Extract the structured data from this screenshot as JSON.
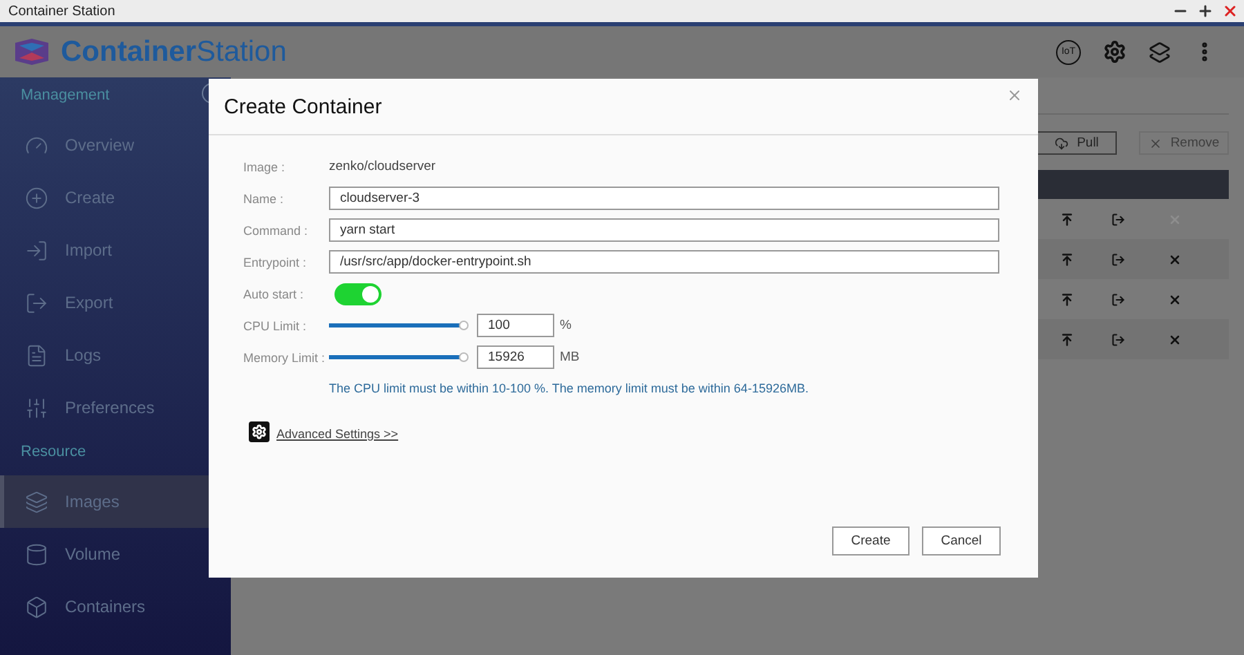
{
  "window": {
    "title": "Container Station"
  },
  "app": {
    "logo_bold": "Container",
    "logo_light": "Station",
    "iot_badge": "IoT"
  },
  "sidebar": {
    "sections": [
      {
        "title": "Management",
        "items": [
          {
            "label": "Overview",
            "selected": false
          },
          {
            "label": "Create",
            "selected": false
          },
          {
            "label": "Import",
            "selected": false
          },
          {
            "label": "Export",
            "selected": false
          },
          {
            "label": "Logs",
            "selected": false
          },
          {
            "label": "Preferences",
            "selected": false
          }
        ]
      },
      {
        "title": "Resource",
        "items": [
          {
            "label": "Images",
            "selected": true
          },
          {
            "label": "Volume",
            "selected": false
          },
          {
            "label": "Containers",
            "selected": false
          }
        ]
      }
    ]
  },
  "toolbar": {
    "buttons": [
      {
        "label": "Pull",
        "kind": "pull",
        "disabled": false
      },
      {
        "label": "Remove",
        "kind": "remove",
        "disabled": true
      }
    ]
  },
  "table": {
    "rows": [
      {
        "remove_disabled": true
      },
      {
        "remove_disabled": false
      },
      {
        "remove_disabled": false
      },
      {
        "remove_disabled": false
      }
    ]
  },
  "dialog": {
    "title": "Create Container",
    "image_label": "Image :",
    "image": "zenko/cloudserver",
    "fields": [
      {
        "label": "Name :",
        "value": "cloudserver-3"
      },
      {
        "label": "Command :",
        "value": "yarn start"
      },
      {
        "label": "Entrypoint :",
        "value": "/usr/src/app/docker-entrypoint.sh"
      }
    ],
    "auto_start": {
      "label": "Auto start :",
      "on": true
    },
    "limits": [
      {
        "label": "CPU Limit :",
        "level": 1,
        "value": "100",
        "unit": "%"
      },
      {
        "label": "Memory Limit :",
        "level": 1,
        "value": "15926",
        "unit": "MB"
      }
    ],
    "hint": "The CPU limit must be within 10-100 %. The memory limit must be within 64-15926MB.",
    "advanced": "Advanced Settings >>",
    "buttons": [
      "Create",
      "Cancel"
    ]
  }
}
